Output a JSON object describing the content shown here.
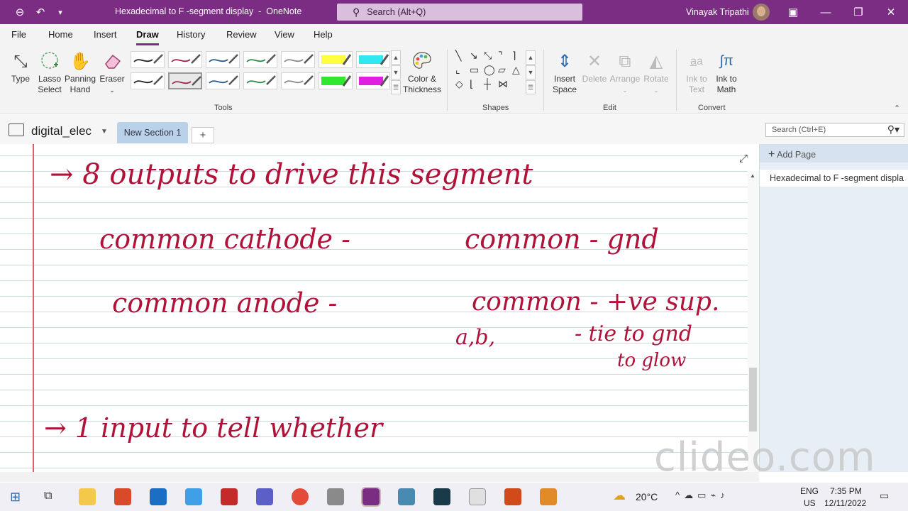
{
  "window": {
    "title": "Hexadecimal to F -segment display  -  OneNote",
    "search_placeholder": "Search (Alt+Q)",
    "user_name": "Vinayak Tripathi"
  },
  "menu": [
    "File",
    "Home",
    "Insert",
    "Draw",
    "History",
    "Review",
    "View",
    "Help"
  ],
  "active_menu": "Draw",
  "ribbon": {
    "type": "Type",
    "lasso_1": "Lasso",
    "lasso_2": "Select",
    "panning_1": "Panning",
    "panning_2": "Hand",
    "eraser": "Eraser",
    "color_1": "Color &",
    "color_2": "Thickness",
    "insert_space_1": "Insert",
    "insert_space_2": "Space",
    "delete": "Delete",
    "arrange": "Arrange",
    "rotate": "Rotate",
    "ink_text_1": "Ink to",
    "ink_text_2": "Text",
    "ink_math_1": "Ink to",
    "ink_math_2": "Math",
    "group_tools": "Tools",
    "group_shapes": "Shapes",
    "group_edit": "Edit",
    "group_convert": "Convert"
  },
  "pens": [
    {
      "color": "#222222"
    },
    {
      "color": "#a3224a"
    },
    {
      "color": "#2a5a8a"
    },
    {
      "color": "#2e8b4a"
    },
    {
      "color": "#8a8a8a"
    },
    {
      "color": "#ffff40",
      "highlighter": true
    },
    {
      "color": "#30e8f0",
      "highlighter": true
    },
    {
      "color": "#222222"
    },
    {
      "color": "#a3224a",
      "selected": true
    },
    {
      "color": "#2a5a8a"
    },
    {
      "color": "#2e8b4a"
    },
    {
      "color": "#8a8a8a"
    },
    {
      "color": "#30e830",
      "highlighter": true
    },
    {
      "color": "#e020e0",
      "highlighter": true
    }
  ],
  "notebook": {
    "name": "digital_elec",
    "section": "New Section 1",
    "page_search": "Search (Ctrl+E)",
    "add_page": "Add Page",
    "page": "Hexadecimal to F -segment displa"
  },
  "ink_notes": [
    "→ 8 outputs to drive this segment",
    "common cathode -",
    "common - gnd",
    "common anode -",
    "common - +ve sup.",
    "a,b,",
    "- tie to gnd",
    "to glow",
    "→ 1 input to tell whether"
  ],
  "taskbar": {
    "weather": "20°C",
    "lang_1": "ENG",
    "lang_2": "US",
    "time": "7:35 PM",
    "date": "12/11/2022"
  },
  "watermark": "clideo.com"
}
